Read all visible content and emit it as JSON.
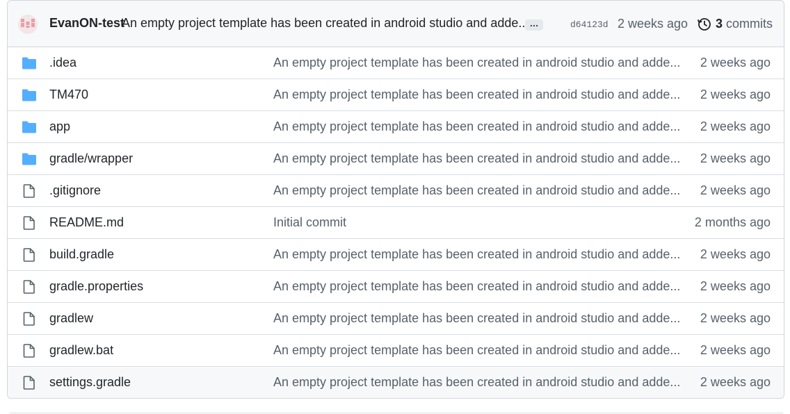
{
  "latest_commit": {
    "author": "EvanON-test",
    "message": "An empty project template has been created in android studio and adde...",
    "ellipsis": "…",
    "sha": "d64123d",
    "date": "2 weeks ago",
    "commits_count": "3",
    "commits_label": "commits"
  },
  "files": [
    {
      "name": ".idea",
      "type": "folder",
      "message": "An empty project template has been created in android studio and adde...",
      "date": "2 weeks ago"
    },
    {
      "name": "TM470",
      "type": "folder",
      "message": "An empty project template has been created in android studio and adde...",
      "date": "2 weeks ago"
    },
    {
      "name": "app",
      "type": "folder",
      "message": "An empty project template has been created in android studio and adde...",
      "date": "2 weeks ago"
    },
    {
      "name": "gradle/wrapper",
      "type": "folder",
      "message": "An empty project template has been created in android studio and adde...",
      "date": "2 weeks ago"
    },
    {
      "name": ".gitignore",
      "type": "file",
      "message": "An empty project template has been created in android studio and adde...",
      "date": "2 weeks ago"
    },
    {
      "name": "README.md",
      "type": "file",
      "message": "Initial commit",
      "date": "2 months ago"
    },
    {
      "name": "build.gradle",
      "type": "file",
      "message": "An empty project template has been created in android studio and adde...",
      "date": "2 weeks ago"
    },
    {
      "name": "gradle.properties",
      "type": "file",
      "message": "An empty project template has been created in android studio and adde...",
      "date": "2 weeks ago"
    },
    {
      "name": "gradlew",
      "type": "file",
      "message": "An empty project template has been created in android studio and adde...",
      "date": "2 weeks ago"
    },
    {
      "name": "gradlew.bat",
      "type": "file",
      "message": "An empty project template has been created in android studio and adde...",
      "date": "2 weeks ago"
    },
    {
      "name": "settings.gradle",
      "type": "file",
      "message": "An empty project template has been created in android studio and adde...",
      "date": "2 weeks ago"
    }
  ],
  "colors": {
    "folder": "#54aeff",
    "file_icon": "#57606a",
    "avatar": "#e6a0a8"
  }
}
